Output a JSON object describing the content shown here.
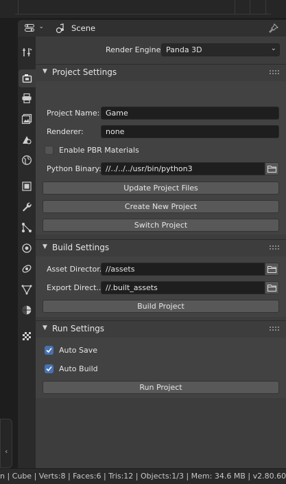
{
  "header": {
    "title": "Scene"
  },
  "render_engine": {
    "label": "Render Engine",
    "value": "Panda 3D"
  },
  "project_settings": {
    "title": "Project Settings",
    "project_name_label": "Project Name:",
    "project_name_value": "Game",
    "renderer_label": "Renderer:",
    "renderer_value": "none",
    "pbr_label": "Enable PBR Materials",
    "pbr_checked": false,
    "python_binary_label": "Python Binary:",
    "python_binary_value": "//../../../usr/bin/python3",
    "update_button": "Update Project Files",
    "create_button": "Create New Project",
    "switch_button": "Switch Project"
  },
  "build_settings": {
    "title": "Build Settings",
    "asset_dir_label": "Asset Director..",
    "asset_dir_value": "//assets",
    "export_dir_label": "Export Direct..",
    "export_dir_value": "//.built_assets",
    "build_button": "Build Project"
  },
  "run_settings": {
    "title": "Run Settings",
    "auto_save_label": "Auto Save",
    "auto_save_checked": true,
    "auto_build_label": "Auto Build",
    "auto_build_checked": true,
    "run_button": "Run Project"
  },
  "statusbar": {
    "text": "n | Cube | Verts:8 | Faces:6 | Tris:12 | Objects:1/3 | Mem: 34.6 MB | v2.80.60"
  },
  "colors": {
    "accent": "#4772b3",
    "panel": "#3d3d3d",
    "field": "#1e1e1e",
    "button": "#585858"
  }
}
